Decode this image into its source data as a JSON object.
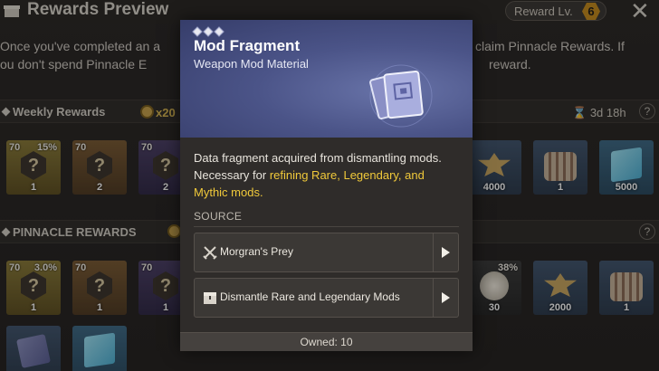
{
  "screen": {
    "title": "Rewards Preview",
    "reward_level_label": "Reward Lv.",
    "reward_level_value": "6",
    "close_icon": "close-x",
    "description_line1_left": "Once you've completed an a",
    "description_line1_right": "claim Pinnacle Rewards. If",
    "description_line2_left": "ou don't spend Pinnacle E",
    "description_line2_right": "reward."
  },
  "weekly": {
    "label": "Weekly Rewards",
    "count": "x20",
    "timer": "3d 18h",
    "help": "?",
    "tiles": [
      {
        "level": "70",
        "pct": "15%",
        "qty": "1",
        "style": "gold"
      },
      {
        "level": "70",
        "pct": "",
        "qty": "2",
        "style": "orange"
      },
      {
        "level": "70",
        "pct": "",
        "qty": "2",
        "style": "purple"
      },
      {
        "level": "",
        "pct": "",
        "qty": "4000",
        "style": "blue"
      },
      {
        "level": "",
        "pct": "",
        "qty": "1",
        "style": "blue"
      },
      {
        "level": "",
        "pct": "",
        "qty": "5000",
        "style": "sky"
      }
    ]
  },
  "pinnacle": {
    "label": "PINNACLE REWARDS",
    "help": "?",
    "tiles": [
      {
        "level": "70",
        "pct": "3.0%",
        "qty": "1",
        "style": "gold"
      },
      {
        "level": "70",
        "pct": "",
        "qty": "1",
        "style": "orange"
      },
      {
        "level": "70",
        "pct": "",
        "qty": "1",
        "style": "purple"
      },
      {
        "level": "",
        "pct": "38%",
        "qty": "30",
        "style": "dark"
      },
      {
        "level": "",
        "pct": "",
        "qty": "2000",
        "style": "blue"
      },
      {
        "level": "",
        "pct": "",
        "qty": "1",
        "style": "blue"
      }
    ]
  },
  "popup": {
    "rarity_pips": 3,
    "title": "Mod Fragment",
    "subtitle": "Weapon Mod Material",
    "icon": "mod-fragment-icon",
    "desc_part1": "Data fragment acquired from dismantling mods. Necessary for ",
    "desc_highlight": "refining Rare, Legendary, and Mythic mods.",
    "source_label": "SOURCE",
    "sources": [
      {
        "label": "Morgran's Prey",
        "icon": "crossed-swords-icon"
      },
      {
        "label": "Dismantle Rare and Legendary Mods",
        "icon": "chest-icon"
      }
    ],
    "owned": "Owned: 10"
  },
  "colors": {
    "popup_header": "#4b5488",
    "highlight": "#f0c93a",
    "popup_body": "#2f2c2a"
  }
}
